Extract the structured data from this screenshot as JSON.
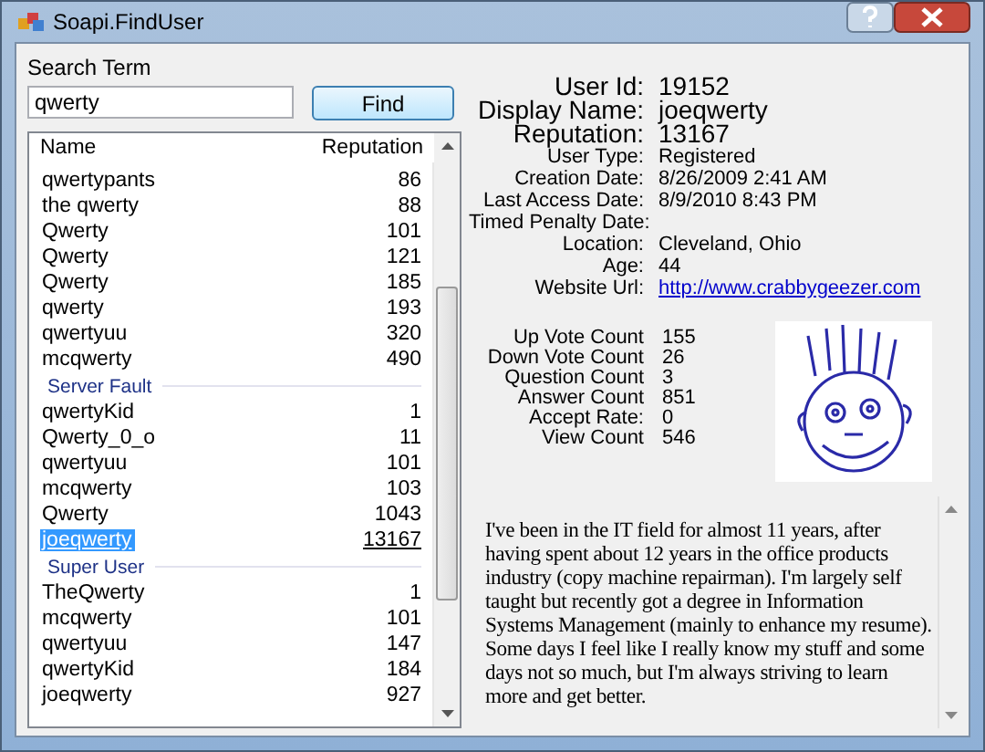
{
  "window": {
    "title": "Soapi.FindUser"
  },
  "search": {
    "label": "Search Term",
    "value": "qwerty",
    "button": "Find"
  },
  "results": {
    "columns": [
      "Name",
      "Reputation"
    ],
    "groups": [
      {
        "rows": [
          {
            "name": "qwertypants",
            "reputation": "86",
            "selected": false
          },
          {
            "name": "the qwerty",
            "reputation": "88",
            "selected": false
          },
          {
            "name": "Qwerty",
            "reputation": "101",
            "selected": false
          },
          {
            "name": "Qwerty",
            "reputation": "121",
            "selected": false
          },
          {
            "name": "Qwerty",
            "reputation": "185",
            "selected": false
          },
          {
            "name": "qwerty",
            "reputation": "193",
            "selected": false
          },
          {
            "name": "qwertyuu",
            "reputation": "320",
            "selected": false
          },
          {
            "name": "mcqwerty",
            "reputation": "490",
            "selected": false
          }
        ]
      },
      {
        "header": "Server Fault",
        "rows": [
          {
            "name": "qwertyKid",
            "reputation": "1",
            "selected": false
          },
          {
            "name": "Qwerty_0_o",
            "reputation": "11",
            "selected": false
          },
          {
            "name": "qwertyuu",
            "reputation": "101",
            "selected": false
          },
          {
            "name": "mcqwerty",
            "reputation": "103",
            "selected": false
          },
          {
            "name": "Qwerty",
            "reputation": "1043",
            "selected": false
          },
          {
            "name": "joeqwerty",
            "reputation": "13167",
            "selected": true
          }
        ]
      },
      {
        "header": "Super User",
        "rows": [
          {
            "name": "TheQwerty",
            "reputation": "1",
            "selected": false
          },
          {
            "name": "mcqwerty",
            "reputation": "101",
            "selected": false
          },
          {
            "name": "qwertyuu",
            "reputation": "147",
            "selected": false
          },
          {
            "name": "qwertyKid",
            "reputation": "184",
            "selected": false
          },
          {
            "name": "joeqwerty",
            "reputation": "927",
            "selected": false
          }
        ]
      }
    ]
  },
  "details": [
    {
      "label": "User Id:",
      "value": "19152",
      "kind": "large"
    },
    {
      "label": "Display Name:",
      "value": "joeqwerty",
      "kind": "large"
    },
    {
      "label": "Reputation:",
      "value": "13167",
      "kind": "large"
    },
    {
      "label": "User Type:",
      "value": "Registered",
      "kind": "plain"
    },
    {
      "label": "Creation Date:",
      "value": "8/26/2009 2:41 AM",
      "kind": "plain"
    },
    {
      "label": "Last Access Date:",
      "value": "8/9/2010 8:43 PM",
      "kind": "plain"
    },
    {
      "label": "Timed Penalty Date:",
      "kind": "plain"
    },
    {
      "label": "Location:",
      "value": "Cleveland, Ohio",
      "kind": "plain"
    },
    {
      "label": "Age:",
      "value": "44",
      "kind": "plain"
    },
    {
      "label": "Website Url:",
      "value": "http://www.crabbygeezer.com",
      "kind": "link"
    }
  ],
  "stats": [
    {
      "label": "Up Vote Count",
      "value": "155"
    },
    {
      "label": "Down Vote Count",
      "value": "26"
    },
    {
      "label": "Question Count",
      "value": "3"
    },
    {
      "label": "Answer Count",
      "value": "851"
    },
    {
      "label": "Accept Rate:",
      "value": "0"
    },
    {
      "label": "View Count",
      "value": "546"
    }
  ],
  "about": "I've been in the IT field for almost 11 years, after having spent about 12 years in the office products industry (copy machine repairman). I'm largely self taught but recently got a degree in Information Systems Management (mainly to enhance my resume). Some days I feel like I really know my stuff and some days not so much, but I'm always striving to learn more and get better."
}
